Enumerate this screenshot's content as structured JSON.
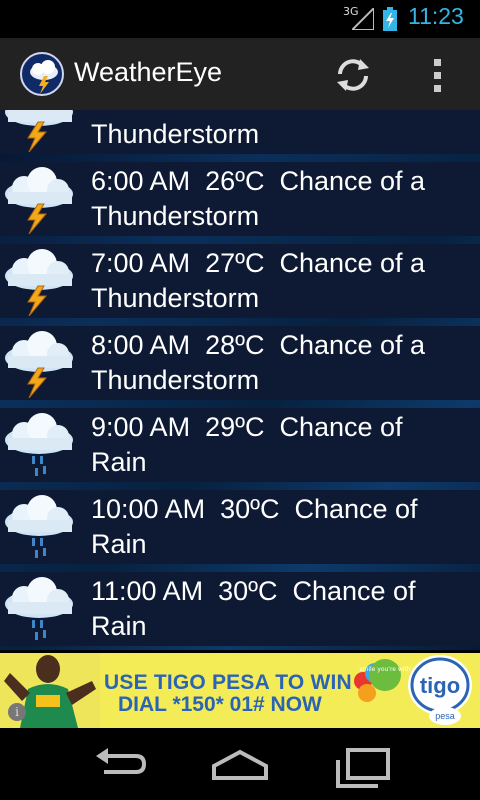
{
  "status_bar": {
    "network": "3G",
    "time": "11:23"
  },
  "action_bar": {
    "app_title": "WeatherEye",
    "refresh_icon": "refresh-icon",
    "overflow_icon": "overflow-menu-icon"
  },
  "forecast": [
    {
      "line1": "",
      "line2": "Thunderstorm",
      "icon": "thunderstorm"
    },
    {
      "line1": "6:00 AM  26ºC  Chance of a",
      "line2": "Thunderstorm",
      "icon": "thunderstorm"
    },
    {
      "line1": "7:00 AM  27ºC  Chance of a",
      "line2": "Thunderstorm",
      "icon": "thunderstorm"
    },
    {
      "line1": "8:00 AM  28ºC  Chance of a",
      "line2": "Thunderstorm",
      "icon": "thunderstorm"
    },
    {
      "line1": "9:00 AM  29ºC  Chance of",
      "line2": "Rain",
      "icon": "rain"
    },
    {
      "line1": "10:00 AM  30ºC  Chance of",
      "line2": "Rain",
      "icon": "rain"
    },
    {
      "line1": "11:00 AM  30ºC  Chance of",
      "line2": "Rain",
      "icon": "rain"
    }
  ],
  "ad": {
    "line1": "USE TIGO PESA TO WIN",
    "line2": "DIAL *150* 01# NOW",
    "brand": "tigo",
    "brand_sub": "pesa",
    "bubble": "smile you're with",
    "info": "i"
  },
  "nav_bar": {
    "back_icon": "back-icon",
    "home_icon": "home-icon",
    "recents_icon": "recent-apps-icon"
  },
  "colors": {
    "accent": "#33b5e5",
    "action_bar": "#222222",
    "row_bg": "#0e1a33",
    "ad_bg": "#f4ec57",
    "ad_text": "#2b64b5"
  }
}
